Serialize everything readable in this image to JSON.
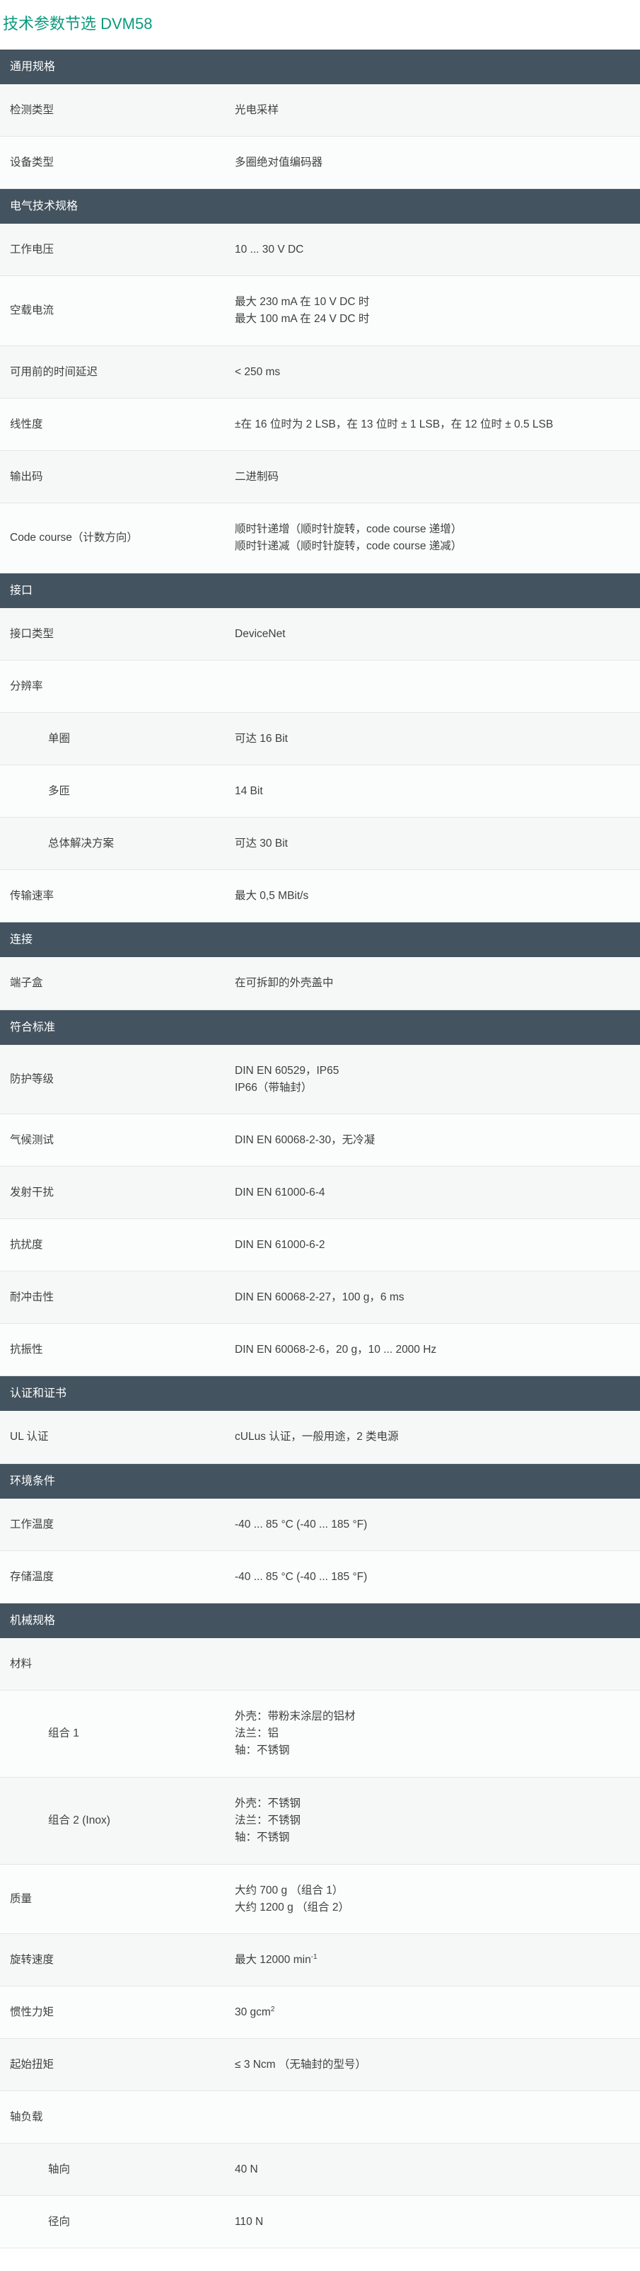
{
  "page_title": "技术参数节选 DVM58",
  "sections": [
    {
      "title": "通用规格",
      "rows": [
        {
          "label": "检测类型",
          "value": [
            "光电采样"
          ],
          "h": 74
        },
        {
          "label": "设备类型",
          "value": [
            "多圈绝对值编码器"
          ],
          "h": 74
        }
      ]
    },
    {
      "title": "电气技术规格",
      "rows": [
        {
          "label": "工作电压",
          "value": [
            "10 ... 30 V DC"
          ],
          "h": 74
        },
        {
          "label": "空载电流",
          "value": [
            "最大 230 mA 在 10 V DC 时",
            "最大 100 mA 在 24 V DC 时"
          ],
          "h": 99
        },
        {
          "label": "可用前的时间延迟",
          "value": [
            "< 250 ms"
          ],
          "h": 74
        },
        {
          "label": "线性度",
          "value": [
            "±在 16 位时为 2 LSB，在 13 位时 ± 1 LSB，在 12 位时 ± 0.5 LSB"
          ],
          "h": 74
        },
        {
          "label": "输出码",
          "value": [
            "二进制码"
          ],
          "h": 74
        },
        {
          "label": "Code course（计数方向）",
          "value": [
            "顺时针递增（顺时针旋转，code course 递增）",
            "顺时针递减（顺时针旋转，code course 递减）"
          ],
          "h": 99
        }
      ]
    },
    {
      "title": "接口",
      "rows": [
        {
          "label": "接口类型",
          "value": [
            "DeviceNet"
          ],
          "h": 74
        },
        {
          "label": "分辨率",
          "value": [],
          "h": 74
        },
        {
          "label": "单圈",
          "value": [
            "可达 16 Bit"
          ],
          "h": 74,
          "sub": true
        },
        {
          "label": "多匝",
          "value": [
            "14 Bit"
          ],
          "h": 74,
          "sub": true
        },
        {
          "label": "总体解决方案",
          "value": [
            "可达 30 Bit"
          ],
          "h": 74,
          "sub": true
        },
        {
          "label": "传输速率",
          "value": [
            "最大 0,5 MBit/s"
          ],
          "h": 74
        }
      ]
    },
    {
      "title": "连接",
      "rows": [
        {
          "label": "端子盒",
          "value": [
            "在可拆卸的外壳盖中"
          ],
          "h": 75
        }
      ]
    },
    {
      "title": "符合标准",
      "rows": [
        {
          "label": "防护等级",
          "value": [
            "DIN EN 60529，IP65",
            "IP66（带轴封）"
          ],
          "h": 98
        },
        {
          "label": "气候测试",
          "value": [
            "DIN EN 60068-2-30，无冷凝"
          ],
          "h": 74
        },
        {
          "label": "发射干扰",
          "value": [
            "DIN EN 61000-6-4"
          ],
          "h": 74
        },
        {
          "label": "抗扰度",
          "value": [
            "DIN EN 61000-6-2"
          ],
          "h": 74
        },
        {
          "label": "耐冲击性",
          "value": [
            "DIN EN 60068-2-27，100 g，6 ms"
          ],
          "h": 74
        },
        {
          "label": "抗振性",
          "value": [
            "DIN EN 60068-2-6，20 g，10 ... 2000 Hz"
          ],
          "h": 74
        }
      ]
    },
    {
      "title": "认证和证书",
      "rows": [
        {
          "label": "UL 认证",
          "value": [
            "cULus 认证，一般用途，2 类电源"
          ],
          "h": 75
        }
      ]
    },
    {
      "title": "环境条件",
      "rows": [
        {
          "label": "工作温度",
          "value": [
            "-40 ... 85 °C (-40 ... 185 °F)"
          ],
          "h": 74
        },
        {
          "label": "存储温度",
          "value": [
            "-40 ... 85 °C (-40 ... 185 °F)"
          ],
          "h": 74
        }
      ]
    },
    {
      "title": "机械规格",
      "rows": [
        {
          "label": "材料",
          "value": [],
          "h": 74
        },
        {
          "label": "组合 1",
          "value": [
            "外壳：带粉末涂层的铝材",
            "法兰：铝",
            "轴：不锈钢"
          ],
          "h": 123,
          "sub": true
        },
        {
          "label": "组合 2 (Inox)",
          "value": [
            "外壳：不锈钢",
            "法兰：不锈钢",
            "轴：不锈钢"
          ],
          "h": 123,
          "sub": true
        },
        {
          "label": "质量",
          "value": [
            "大约 700 g （组合 1）",
            "大约 1200 g （组合 2）"
          ],
          "h": 98
        },
        {
          "label": "旋转速度",
          "value": [
            "最大 12000 min"
          ],
          "sup": "-1",
          "h": 74
        },
        {
          "label": "惯性力矩",
          "value": [
            "30 gcm"
          ],
          "sup": "2",
          "h": 74
        },
        {
          "label": "起始扭矩",
          "value": [
            "≤ 3 Ncm （无轴封的型号）"
          ],
          "h": 74
        },
        {
          "label": "轴负载",
          "value": [],
          "h": 74
        },
        {
          "label": "轴向",
          "value": [
            "40 N"
          ],
          "h": 74,
          "sub": true
        },
        {
          "label": "径向",
          "value": [
            "110 N"
          ],
          "h": 74,
          "sub": true
        }
      ]
    }
  ]
}
